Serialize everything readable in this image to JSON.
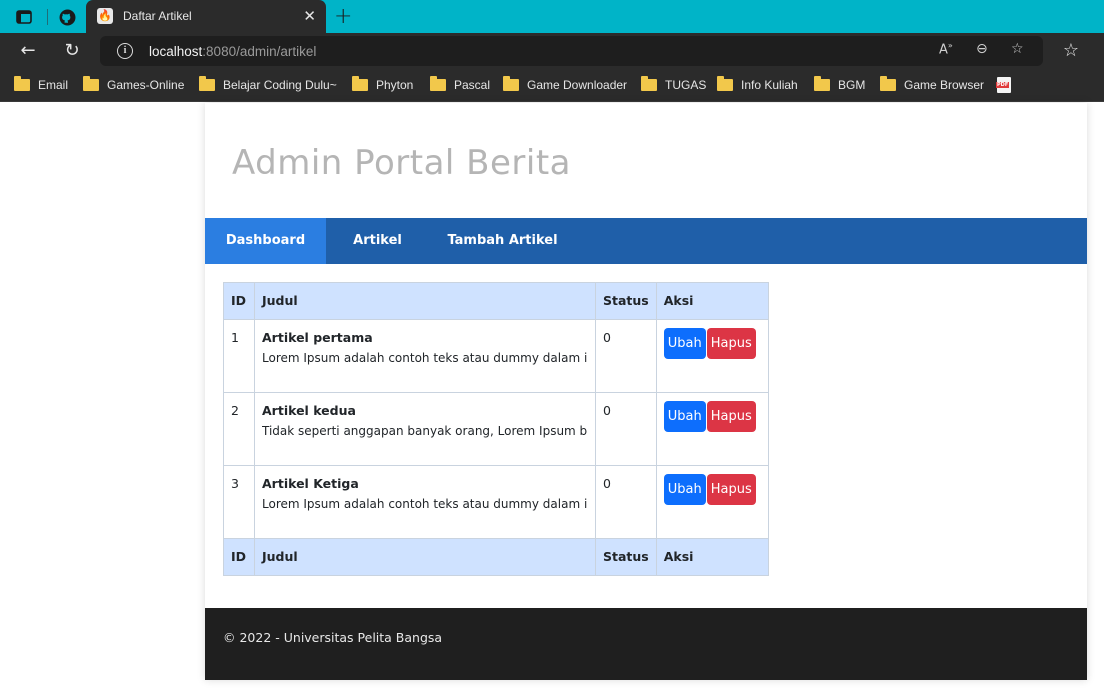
{
  "browser": {
    "tab_title": "Daftar Artikel",
    "url_host": "localhost",
    "url_rest": ":8080/admin/artikel",
    "colors": {
      "titlebar": "#00b4c8",
      "chrome": "#2b2b2b"
    }
  },
  "bookmarks": [
    {
      "label": "Email"
    },
    {
      "label": "Games-Online"
    },
    {
      "label": "Belajar Coding Dulu~"
    },
    {
      "label": "Phyton"
    },
    {
      "label": "Pascal"
    },
    {
      "label": "Game Downloader"
    },
    {
      "label": "TUGAS"
    },
    {
      "label": "Info Kuliah"
    },
    {
      "label": "BGM"
    },
    {
      "label": "Game Browser"
    }
  ],
  "page": {
    "site_title": "Admin Portal Berita",
    "nav": [
      {
        "label": "Dashboard",
        "active": true
      },
      {
        "label": "Artikel",
        "active": false
      },
      {
        "label": "Tambah Artikel",
        "active": false
      }
    ],
    "table": {
      "headers": {
        "id": "ID",
        "judul": "Judul",
        "status": "Status",
        "aksi": "Aksi"
      },
      "rows": [
        {
          "id": "1",
          "title": "Artikel pertama",
          "body": "Lorem Ipsum adalah contoh teks atau dummy dalam in",
          "status": "0"
        },
        {
          "id": "2",
          "title": "Artikel kedua",
          "body": "Tidak seperti anggapan banyak orang, Lorem Ipsum b",
          "status": "0"
        },
        {
          "id": "3",
          "title": "Artikel Ketiga",
          "body": "Lorem Ipsum adalah contoh teks atau dummy dalam in",
          "status": "0"
        }
      ],
      "edit_label": "Ubah",
      "delete_label": "Hapus"
    },
    "footer": "© 2022 - Universitas Pelita Bangsa",
    "colors": {
      "navbar": "#1f5fa9",
      "nav_active": "#2b7ee1",
      "header_bg": "#cfe2ff",
      "btn_edit": "#0d6efd",
      "btn_delete": "#dc3545",
      "footer_bg": "#1f1f1f"
    }
  }
}
